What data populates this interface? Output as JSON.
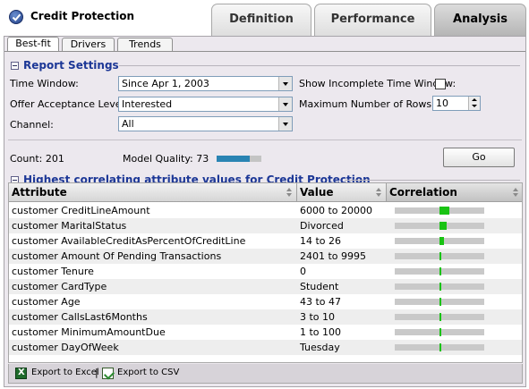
{
  "app": {
    "title": "Credit Protection",
    "icon": "checkmark-icon"
  },
  "main_tabs": [
    {
      "label": "Definition",
      "active": false
    },
    {
      "label": "Performance",
      "active": false
    },
    {
      "label": "Analysis",
      "active": true
    }
  ],
  "sub_tabs": [
    {
      "label": "Best-fit",
      "active": true
    },
    {
      "label": "Drivers",
      "active": false
    },
    {
      "label": "Trends",
      "active": false
    }
  ],
  "report_settings": {
    "title": "Report Settings",
    "time_window_label": "Time Window:",
    "time_window_value": "Since Apr 1, 2003",
    "offer_acceptance_label": "Offer Acceptance Level:",
    "offer_acceptance_value": "Interested",
    "channel_label": "Channel:",
    "channel_value": "All",
    "show_incomplete_label": "Show Incomplete Time Window:",
    "show_incomplete_checked": false,
    "max_rows_label": "Maximum Number of Rows:",
    "max_rows_value": "10"
  },
  "summary": {
    "count_text": "Count: 201",
    "model_quality_label": "Model Quality: 73",
    "model_quality_fraction": 0.73,
    "go_label": "Go"
  },
  "correlation_section": {
    "title": "Highest correlating attribute values for Credit Protection",
    "columns": {
      "attribute": "Attribute",
      "value": "Value",
      "correlation": "Correlation"
    },
    "rows": [
      {
        "attribute": "customer CreditLineAmount",
        "value": "6000 to 20000",
        "correlation": 0.22
      },
      {
        "attribute": "customer MaritalStatus",
        "value": "Divorced",
        "correlation": 0.15
      },
      {
        "attribute": "customer AvailableCreditAsPercentOfCreditLine",
        "value": "14 to 26",
        "correlation": 0.1
      },
      {
        "attribute": "customer Amount Of Pending Transactions",
        "value": "2401 to 9995",
        "correlation": 0.04
      },
      {
        "attribute": "customer Tenure",
        "value": "0",
        "correlation": 0.04
      },
      {
        "attribute": "customer CardType",
        "value": "Student",
        "correlation": 0.04
      },
      {
        "attribute": "customer Age",
        "value": "43 to 47",
        "correlation": 0.04
      },
      {
        "attribute": "customer CallsLast6Months",
        "value": "3 to 10",
        "correlation": 0.03
      },
      {
        "attribute": "customer MinimumAmountDue",
        "value": "1 to 100",
        "correlation": 0.03
      },
      {
        "attribute": "customer DayOfWeek",
        "value": "Tuesday",
        "correlation": 0.02
      }
    ]
  },
  "footer": {
    "export_excel": "Export to Excel",
    "separator": "|",
    "export_csv": "Export to CSV"
  },
  "colors": {
    "accent_title": "#1c3796",
    "correlation_bar": "#19c313",
    "quality_bar": "#2a84b3"
  }
}
